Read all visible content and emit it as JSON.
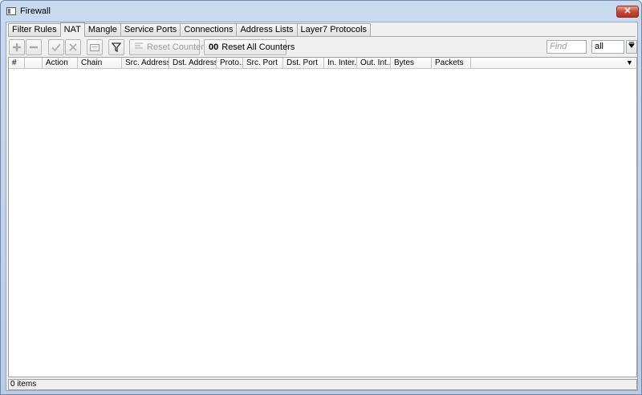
{
  "window": {
    "title": "Firewall",
    "close_label": "✕"
  },
  "tabs": [
    {
      "label": "Filter Rules"
    },
    {
      "label": "NAT",
      "active": true
    },
    {
      "label": "Mangle"
    },
    {
      "label": "Service Ports"
    },
    {
      "label": "Connections"
    },
    {
      "label": "Address Lists"
    },
    {
      "label": "Layer7 Protocols"
    }
  ],
  "toolbar": {
    "add_icon": "plus-icon",
    "remove_icon": "minus-icon",
    "enable_icon": "check-icon",
    "disable_icon": "x-icon",
    "comment_icon": "comment-icon",
    "filter_icon": "funnel-icon",
    "reset_counters_label": "Reset Counters",
    "reset_all_counters_label": "Reset All Counters",
    "reset_all_counters_prefix": "00"
  },
  "search": {
    "placeholder": "Find",
    "value": ""
  },
  "filter_select": {
    "value": "all"
  },
  "table": {
    "columns": [
      "#",
      "",
      "Action",
      "Chain",
      "Src. Address",
      "Dst. Address",
      "Proto...",
      "Src. Port",
      "Dst. Port",
      "In. Inter...",
      "Out. Int...",
      "Bytes",
      "Packets"
    ],
    "rows": []
  },
  "status": {
    "text": "0 items"
  }
}
